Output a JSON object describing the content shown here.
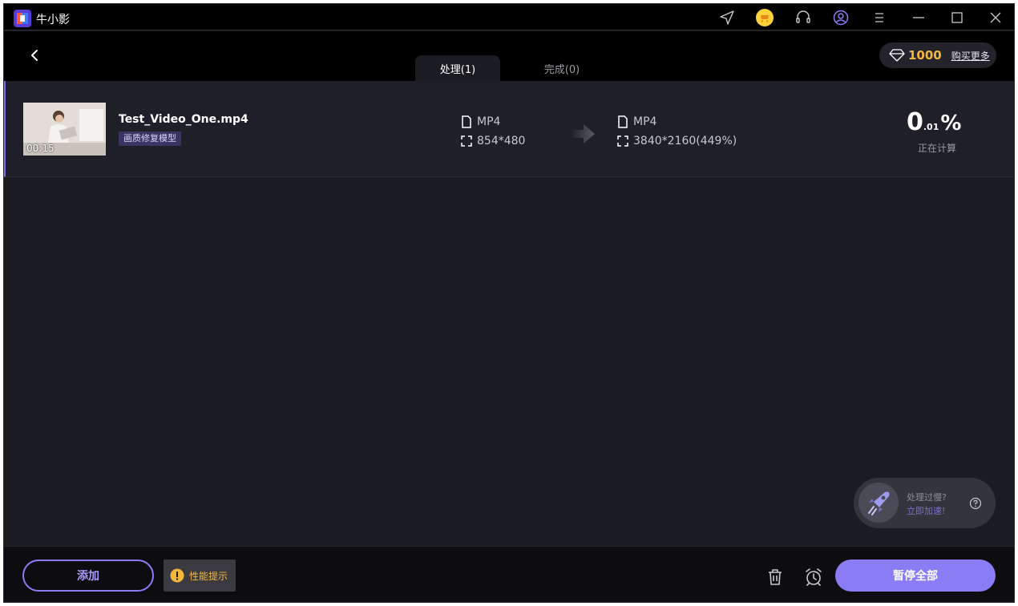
{
  "app": {
    "title": "牛小影"
  },
  "tabs": [
    {
      "label": "处理(1)",
      "active": true
    },
    {
      "label": "完成(0)",
      "active": false
    }
  ],
  "points": {
    "value": "1000",
    "buy_label": "购买更多"
  },
  "task": {
    "file_name": "Test_Video_One.mp4",
    "duration": "00:15",
    "model_tag": "画质修复模型",
    "source": {
      "format": "MP4",
      "resolution": "854*480"
    },
    "target": {
      "format": "MP4",
      "resolution": "3840*2160(449%)"
    },
    "progress": {
      "int": "0",
      "dec": ".01",
      "unit": "%",
      "status": "正在计算"
    }
  },
  "speedup": {
    "question": "处理过慢?",
    "action": "立即加速!"
  },
  "footer": {
    "add_label": "添加",
    "perf_label": "性能提示",
    "pause_all_label": "暂停全部"
  },
  "colors": {
    "accent": "#8a7cf5",
    "gold": "#f5b73b",
    "background": "#1b1c22"
  }
}
